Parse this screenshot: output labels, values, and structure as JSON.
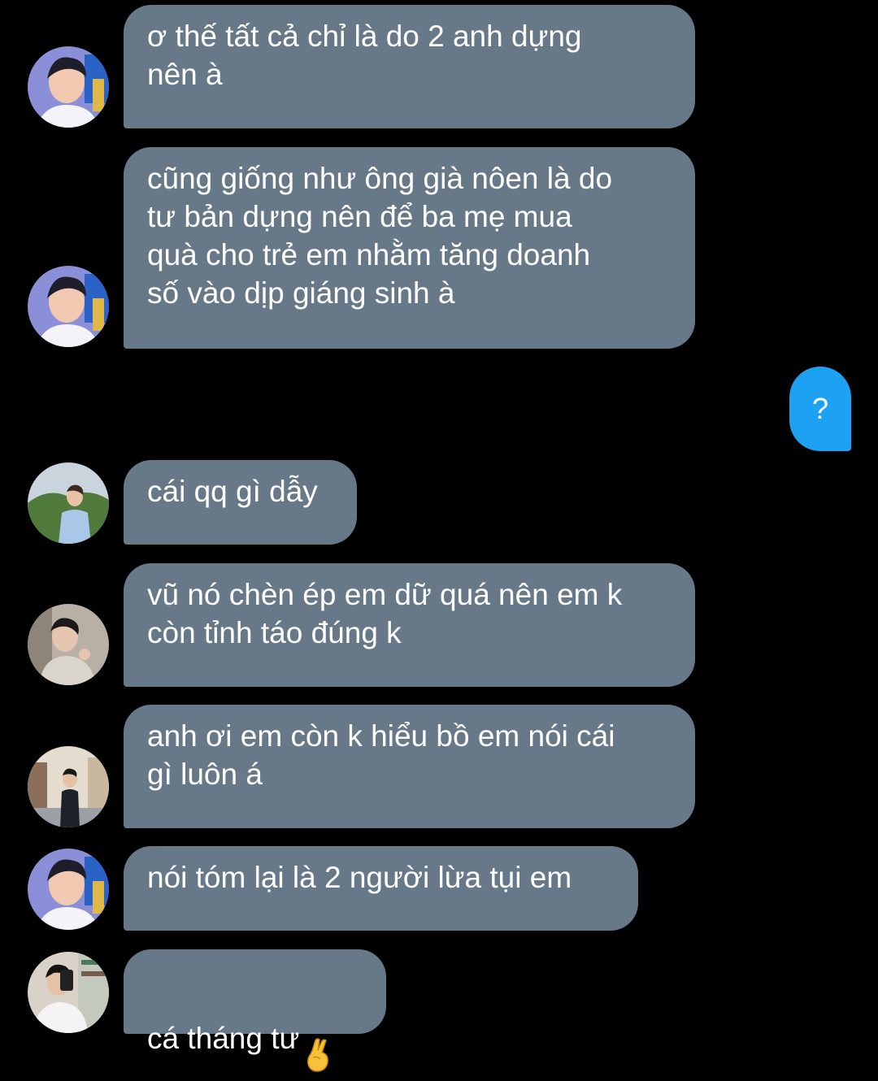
{
  "messages": [
    {
      "sender": "incoming",
      "avatar": "avatar-a",
      "text": "ơ thế tất cả chỉ là do 2 anh dựng\nnên à"
    },
    {
      "sender": "incoming",
      "avatar": "avatar-a",
      "text": "cũng giống như ông già nôen là do\ntư bản dựng nên để ba mẹ mua\nquà cho trẻ em nhằm tăng doanh\nsố vào dịp giáng sinh à"
    },
    {
      "sender": "outgoing",
      "text": "?"
    },
    {
      "sender": "incoming",
      "avatar": "avatar-b",
      "text": "cái qq gì dẫy"
    },
    {
      "sender": "incoming",
      "avatar": "avatar-c",
      "text": "vũ nó chèn ép em dữ quá nên em k\ncòn tỉnh táo đúng k"
    },
    {
      "sender": "incoming",
      "avatar": "avatar-d",
      "text": "anh ơi em còn k hiểu bồ em nói cái\ngì luôn á"
    },
    {
      "sender": "incoming",
      "avatar": "avatar-a",
      "text": "nói tóm lại là 2 người lừa tụi em"
    },
    {
      "sender": "incoming",
      "avatar": "avatar-e",
      "text": "cá tháng tư",
      "emoji": "crossed-fingers-icon"
    }
  ],
  "colors": {
    "background": "#000000",
    "incoming_bubble": "#677888",
    "outgoing_bubble": "#1da1f2",
    "text": "#ffffff"
  }
}
